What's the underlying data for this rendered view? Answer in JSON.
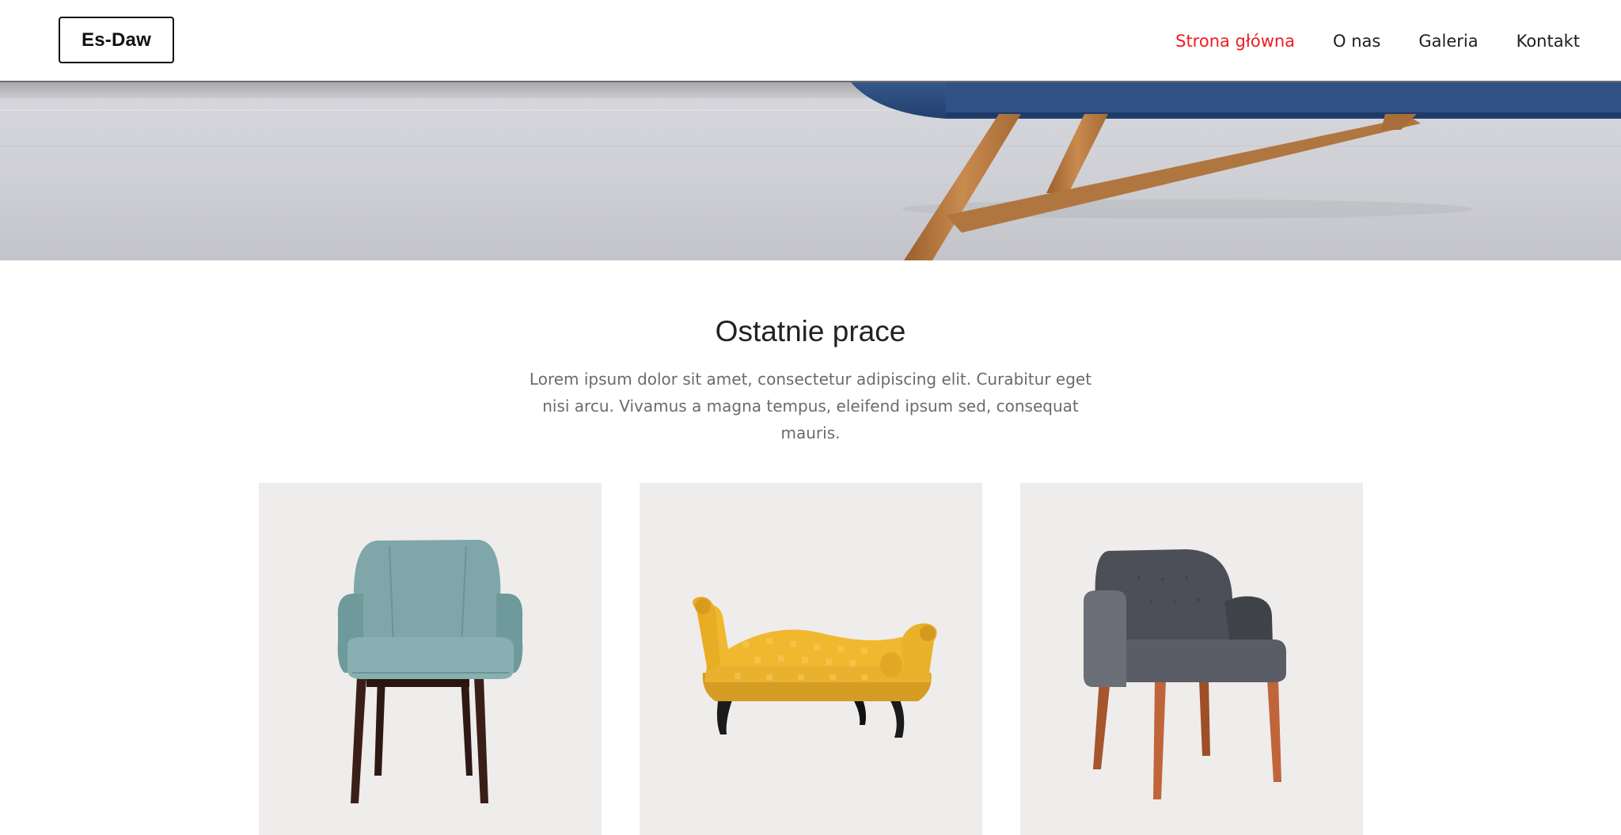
{
  "header": {
    "logo": "Es-Daw",
    "nav": [
      {
        "label": "Strona główna",
        "active": true
      },
      {
        "label": "O nas",
        "active": false
      },
      {
        "label": "Galeria",
        "active": false
      },
      {
        "label": "Kontakt",
        "active": false
      }
    ]
  },
  "colors": {
    "accent": "#ed1c24",
    "text": "#1e1e1e",
    "muted": "#6b6b6b",
    "card_bg": "#efecec"
  },
  "section": {
    "title": "Ostatnie prace",
    "description": "Lorem ipsum dolor sit amet, consectetur adipiscing elit. Curabitur eget nisi arcu. Vivamus a magna tempus, eleifend ipsum sed, consequat mauris."
  },
  "cards": [
    {
      "product": "teal-armchair-image"
    },
    {
      "product": "yellow-chaise-longue-image"
    },
    {
      "product": "grey-armchair-image"
    }
  ]
}
